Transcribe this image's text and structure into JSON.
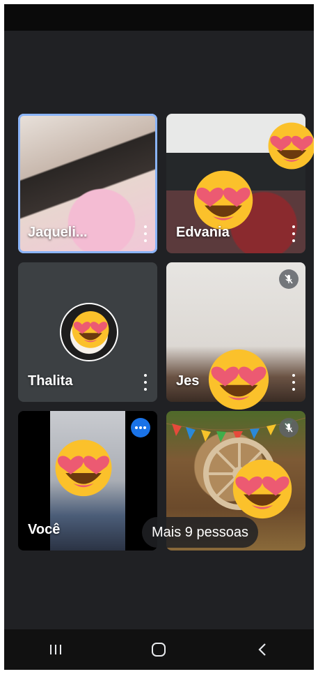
{
  "participants": [
    {
      "name": "Jaqueli...",
      "active": true
    },
    {
      "name": "Edvania"
    },
    {
      "name": "Thalita"
    },
    {
      "name": "Jes"
    },
    {
      "name": "Você"
    }
  ],
  "more_people_label": "Mais 9 pessoas",
  "colors": {
    "background": "#202124",
    "tile": "#3c4043",
    "active_border": "#8ab4f8",
    "speaking": "#1a73e8"
  },
  "icons": {
    "overflow": "more-vert-icon",
    "muted": "mic-off-icon",
    "speaking": "speaking-indicator-icon",
    "nav_recents": "recents-icon",
    "nav_home": "home-icon",
    "nav_back": "back-icon"
  }
}
